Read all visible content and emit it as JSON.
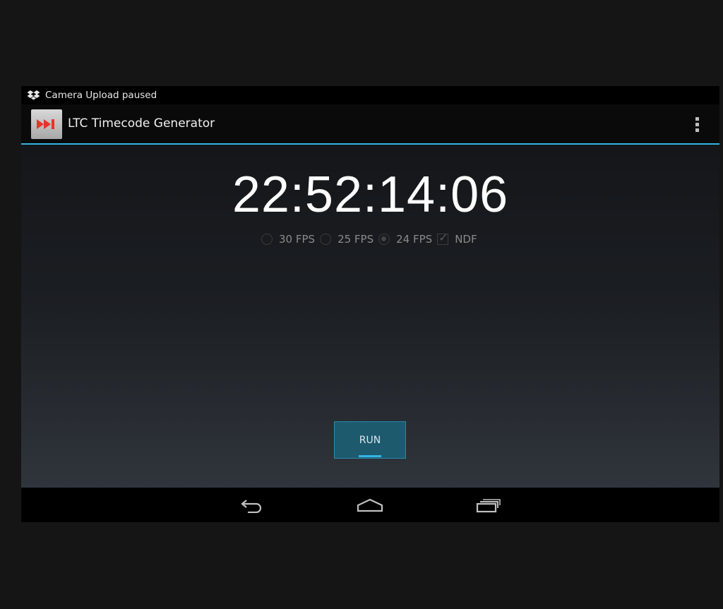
{
  "status_bar": {
    "notification_icon": "dropbox-icon",
    "notification_text": "Camera Upload paused"
  },
  "action_bar": {
    "app_icon": "fast-forward-icon",
    "title": "LTC Timecode Generator",
    "overflow_icon": "overflow-menu-icon"
  },
  "main": {
    "timecode": "22:52:14:06",
    "frame_rates": [
      {
        "label": "30 FPS",
        "selected": false
      },
      {
        "label": "25 FPS",
        "selected": false
      },
      {
        "label": "24 FPS",
        "selected": true
      }
    ],
    "ndf": {
      "label": "NDF",
      "checked": true
    },
    "run_label": "RUN"
  },
  "nav_bar": {
    "back_icon": "back-icon",
    "home_icon": "home-icon",
    "recents_icon": "recent-apps-icon"
  },
  "colors": {
    "accent": "#33b5e5",
    "app_icon_arrows": "#e8332a",
    "button_bg": "#1e5a6e"
  }
}
